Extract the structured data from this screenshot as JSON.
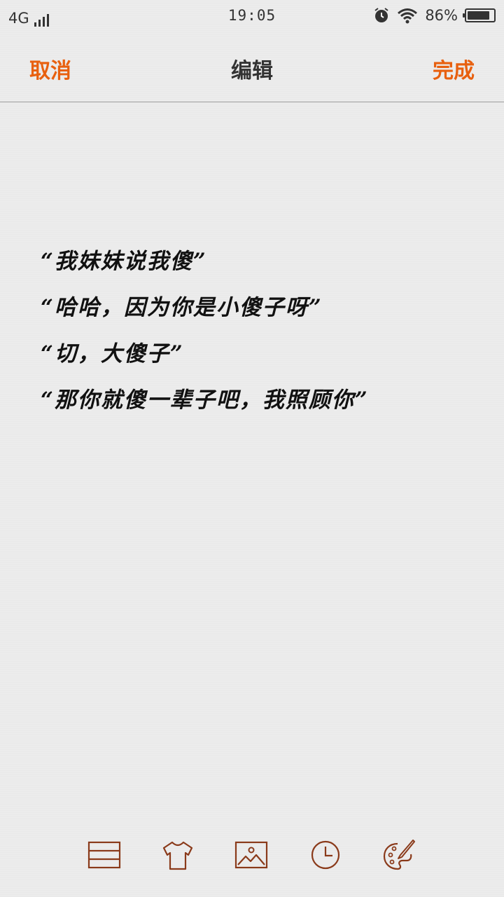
{
  "status_bar": {
    "network": "4G",
    "time": "19:05",
    "battery_percent": "86%"
  },
  "header": {
    "cancel_label": "取消",
    "title": "编辑",
    "done_label": "完成"
  },
  "note": {
    "lines": [
      "“我妹妹说我傻”",
      "“哈哈，因为你是小傻子呀”",
      "“切，大傻子”",
      "“那你就傻一辈子吧，我照顾你”"
    ]
  },
  "toolbar": {
    "icons": [
      "lines-icon",
      "shirt-icon",
      "image-icon",
      "clock-icon",
      "palette-icon"
    ]
  },
  "colors": {
    "accent": "#e8600f",
    "icon": "#8a3a1a",
    "background": "#ececec"
  }
}
